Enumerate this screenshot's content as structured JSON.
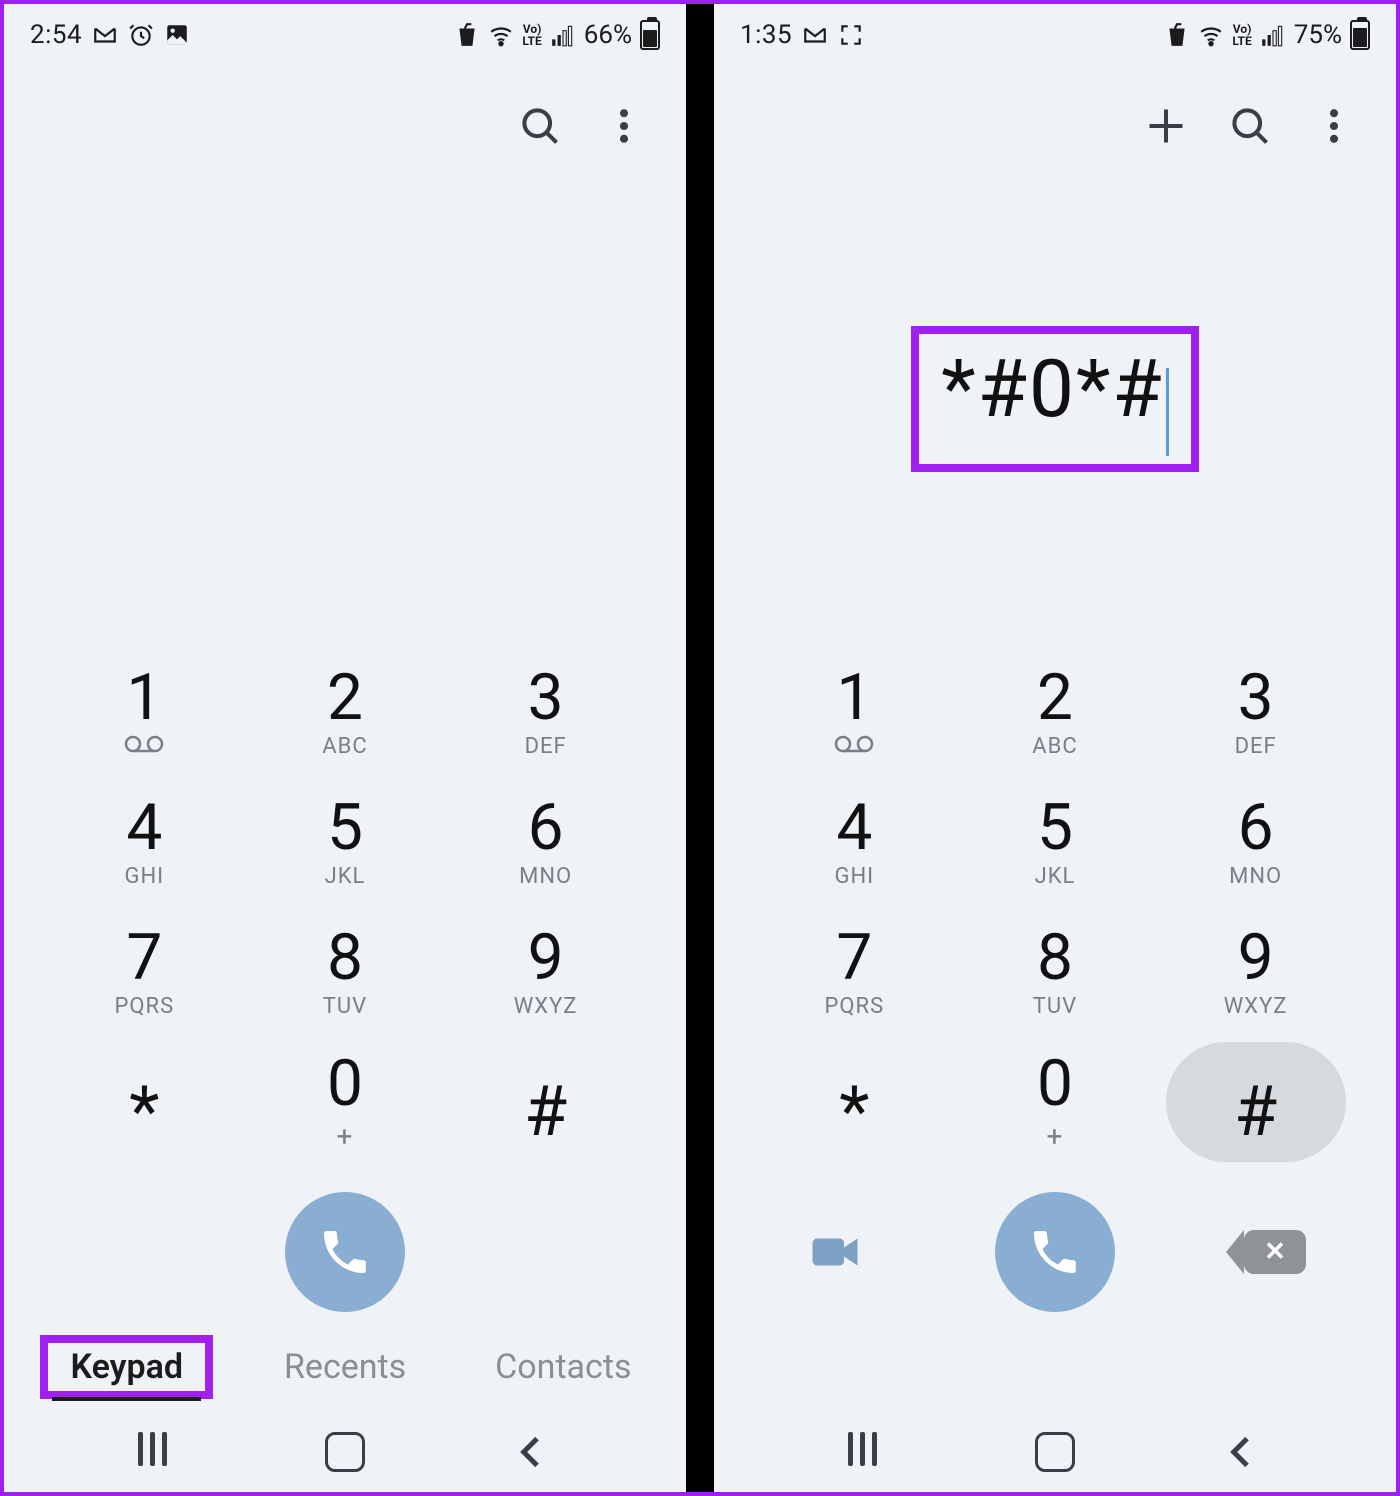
{
  "highlight_color": "#a020f0",
  "accent_call": "#8aaed1",
  "left": {
    "status": {
      "time": "2:54",
      "battery_pct": "66%",
      "battery_level": 66
    },
    "toolbar": {
      "show_add": false
    },
    "dialed": "",
    "highlight_dialed": false,
    "keypad_pressed": null,
    "show_video": false,
    "show_backspace": false,
    "tabs": {
      "items": [
        {
          "label": "Keypad",
          "active": true
        },
        {
          "label": "Recents",
          "active": false
        },
        {
          "label": "Contacts",
          "active": false
        }
      ],
      "highlight_active": true
    },
    "show_tabs": true
  },
  "right": {
    "status": {
      "time": "1:35",
      "battery_pct": "75%",
      "battery_level": 75
    },
    "toolbar": {
      "show_add": true
    },
    "dialed": "*#0*#",
    "highlight_dialed": true,
    "keypad_pressed": "#",
    "show_video": true,
    "show_backspace": true,
    "show_tabs": false
  },
  "keypad": [
    [
      {
        "d": "1",
        "s": "vm"
      },
      {
        "d": "2",
        "s": "ABC"
      },
      {
        "d": "3",
        "s": "DEF"
      }
    ],
    [
      {
        "d": "4",
        "s": "GHI"
      },
      {
        "d": "5",
        "s": "JKL"
      },
      {
        "d": "6",
        "s": "MNO"
      }
    ],
    [
      {
        "d": "7",
        "s": "PQRS"
      },
      {
        "d": "8",
        "s": "TUV"
      },
      {
        "d": "9",
        "s": "WXYZ"
      }
    ],
    [
      {
        "d": "*",
        "s": ""
      },
      {
        "d": "0",
        "s": "+"
      },
      {
        "d": "#",
        "s": ""
      }
    ]
  ]
}
